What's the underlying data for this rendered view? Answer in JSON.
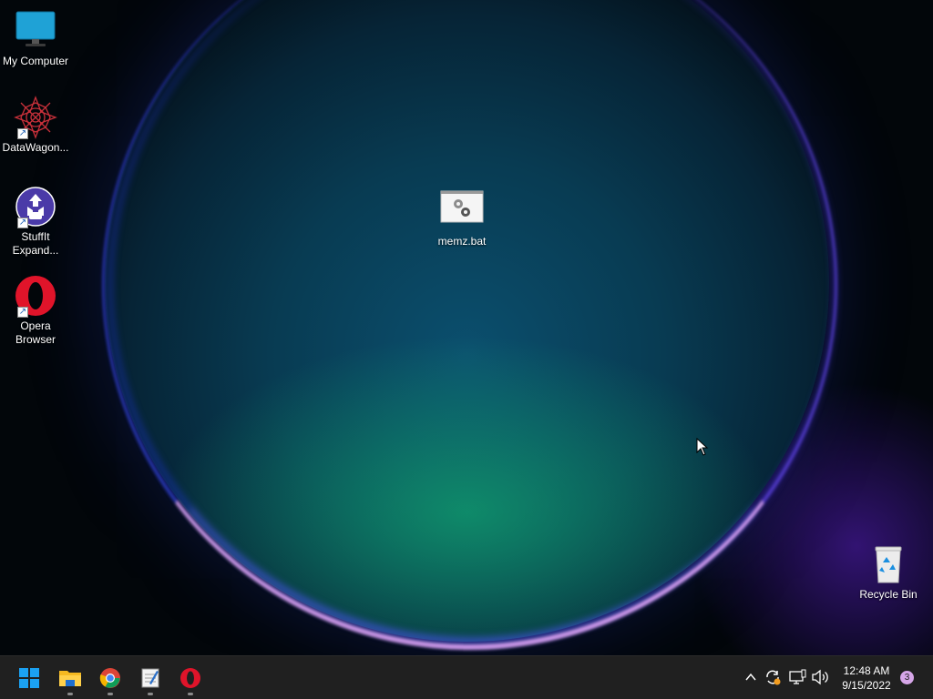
{
  "desktop": {
    "icons": [
      {
        "label": "My Computer",
        "icon": "monitor-icon"
      },
      {
        "label": "DataWagon...",
        "icon": "datawagon-icon"
      },
      {
        "label": "StuffIt Expand...",
        "icon": "stuffit-icon"
      },
      {
        "label": "Opera Browser",
        "icon": "opera-icon"
      },
      {
        "label": "memz.bat",
        "icon": "batch-file-icon"
      },
      {
        "label": "Recycle Bin",
        "icon": "recycle-bin-icon"
      }
    ]
  },
  "taskbar": {
    "apps": [
      {
        "name": "Start",
        "icon": "windows-start-icon"
      },
      {
        "name": "File Explorer",
        "icon": "folder-icon"
      },
      {
        "name": "Google Chrome",
        "icon": "chrome-icon"
      },
      {
        "name": "Notepad",
        "icon": "notepad-icon"
      },
      {
        "name": "Opera",
        "icon": "opera-icon"
      }
    ],
    "tray": {
      "time": "12:48 AM",
      "date": "9/15/2022",
      "notification_count": "3"
    }
  },
  "colors": {
    "taskbar_bg": "#202020",
    "accent": "#0a84d8"
  }
}
